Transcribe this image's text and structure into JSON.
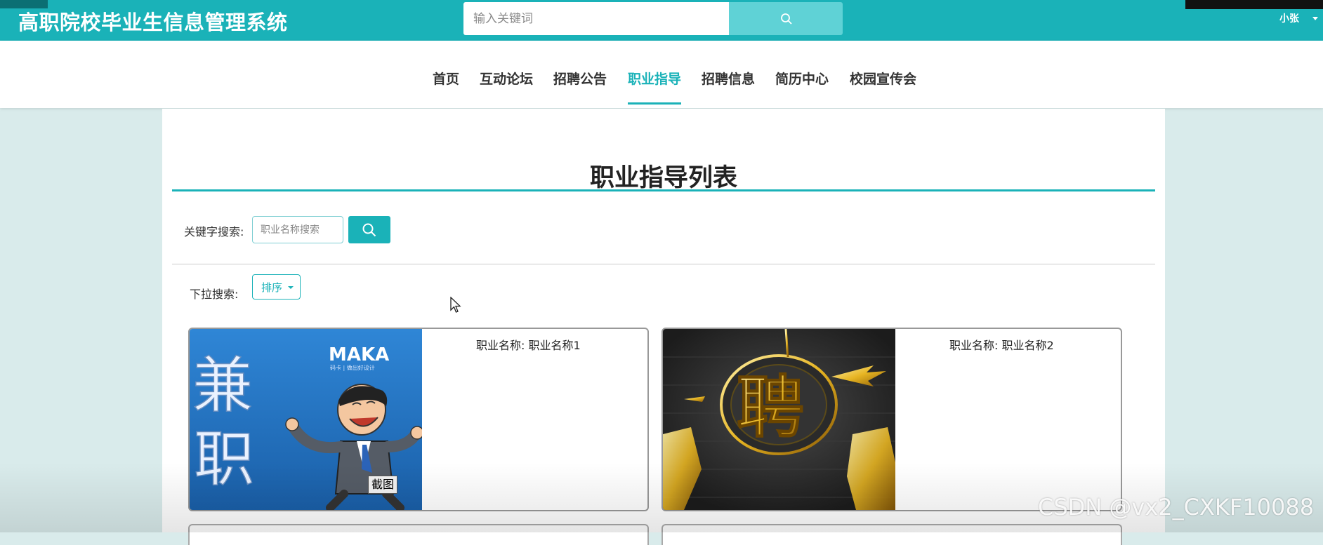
{
  "header": {
    "site_title": "高职院校毕业生信息管理系统",
    "search_placeholder": "输入关键词",
    "user_name": "小张"
  },
  "nav": {
    "items": [
      "首页",
      "互动论坛",
      "招聘公告",
      "职业指导",
      "招聘信息",
      "简历中心",
      "校园宣传会"
    ],
    "active": "职业指导"
  },
  "main": {
    "heading": "职业指导列表",
    "keyword_label": "关键字搜索:",
    "keyword_placeholder": "职业名称搜索",
    "dropdown_label": "下拉搜索:",
    "sort_label": "排序"
  },
  "cards": [
    {
      "title": "职业名称: 职业名称1",
      "image": {
        "brand": "MAKA",
        "tagline": "码卡 | 做出好设计",
        "big_text_top": "兼",
        "big_text_bottom": "职"
      }
    },
    {
      "title": "职业名称: 职业名称2",
      "image": {
        "glyph": "聘"
      }
    }
  ],
  "overlay": {
    "screenshot_badge": "截图",
    "watermark": "CSDN @vx2_CXKF10088"
  },
  "colors": {
    "accent": "#1ab2b8",
    "page_bg": "#d9ebeb"
  }
}
